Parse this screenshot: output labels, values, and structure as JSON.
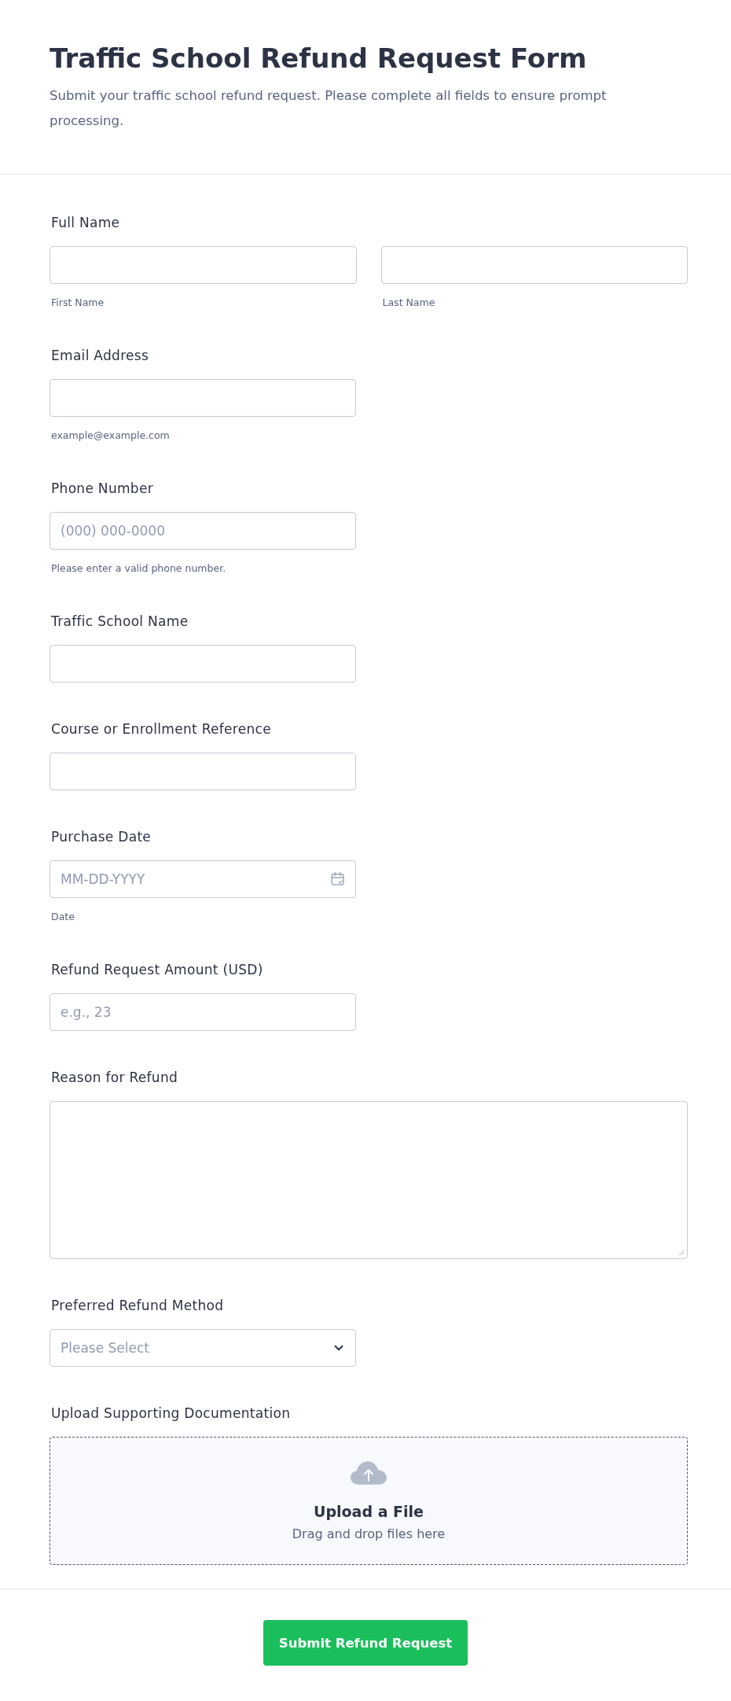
{
  "header": {
    "title": "Traffic School Refund Request Form",
    "subtitle": "Submit your traffic school refund request. Please complete all fields to ensure prompt processing."
  },
  "fields": [
    {
      "kind": "name",
      "label": "Full Name",
      "inputs": [
        {
          "sublabel": "First Name"
        },
        {
          "sublabel": "Last Name"
        }
      ]
    },
    {
      "kind": "text",
      "label": "Email Address",
      "sublabel": "example@example.com"
    },
    {
      "kind": "text",
      "label": "Phone Number",
      "placeholder": "(000) 000-0000",
      "sublabel": "Please enter a valid phone number."
    },
    {
      "kind": "text",
      "label": "Traffic School Name"
    },
    {
      "kind": "text",
      "label": "Course or Enrollment Reference"
    },
    {
      "kind": "date",
      "label": "Purchase Date",
      "placeholder": "MM-DD-YYYY",
      "sublabel": "Date"
    },
    {
      "kind": "text",
      "label": "Refund Request Amount (USD)",
      "placeholder": "e.g., 23"
    },
    {
      "kind": "textarea",
      "label": "Reason for Refund"
    },
    {
      "kind": "select",
      "label": "Preferred Refund Method",
      "placeholder": "Please Select"
    },
    {
      "kind": "upload",
      "label": "Upload Supporting Documentation",
      "title": "Upload a File",
      "hint": "Drag and drop files here"
    }
  ],
  "submit_button": {
    "label": "Submit Refund Request"
  }
}
